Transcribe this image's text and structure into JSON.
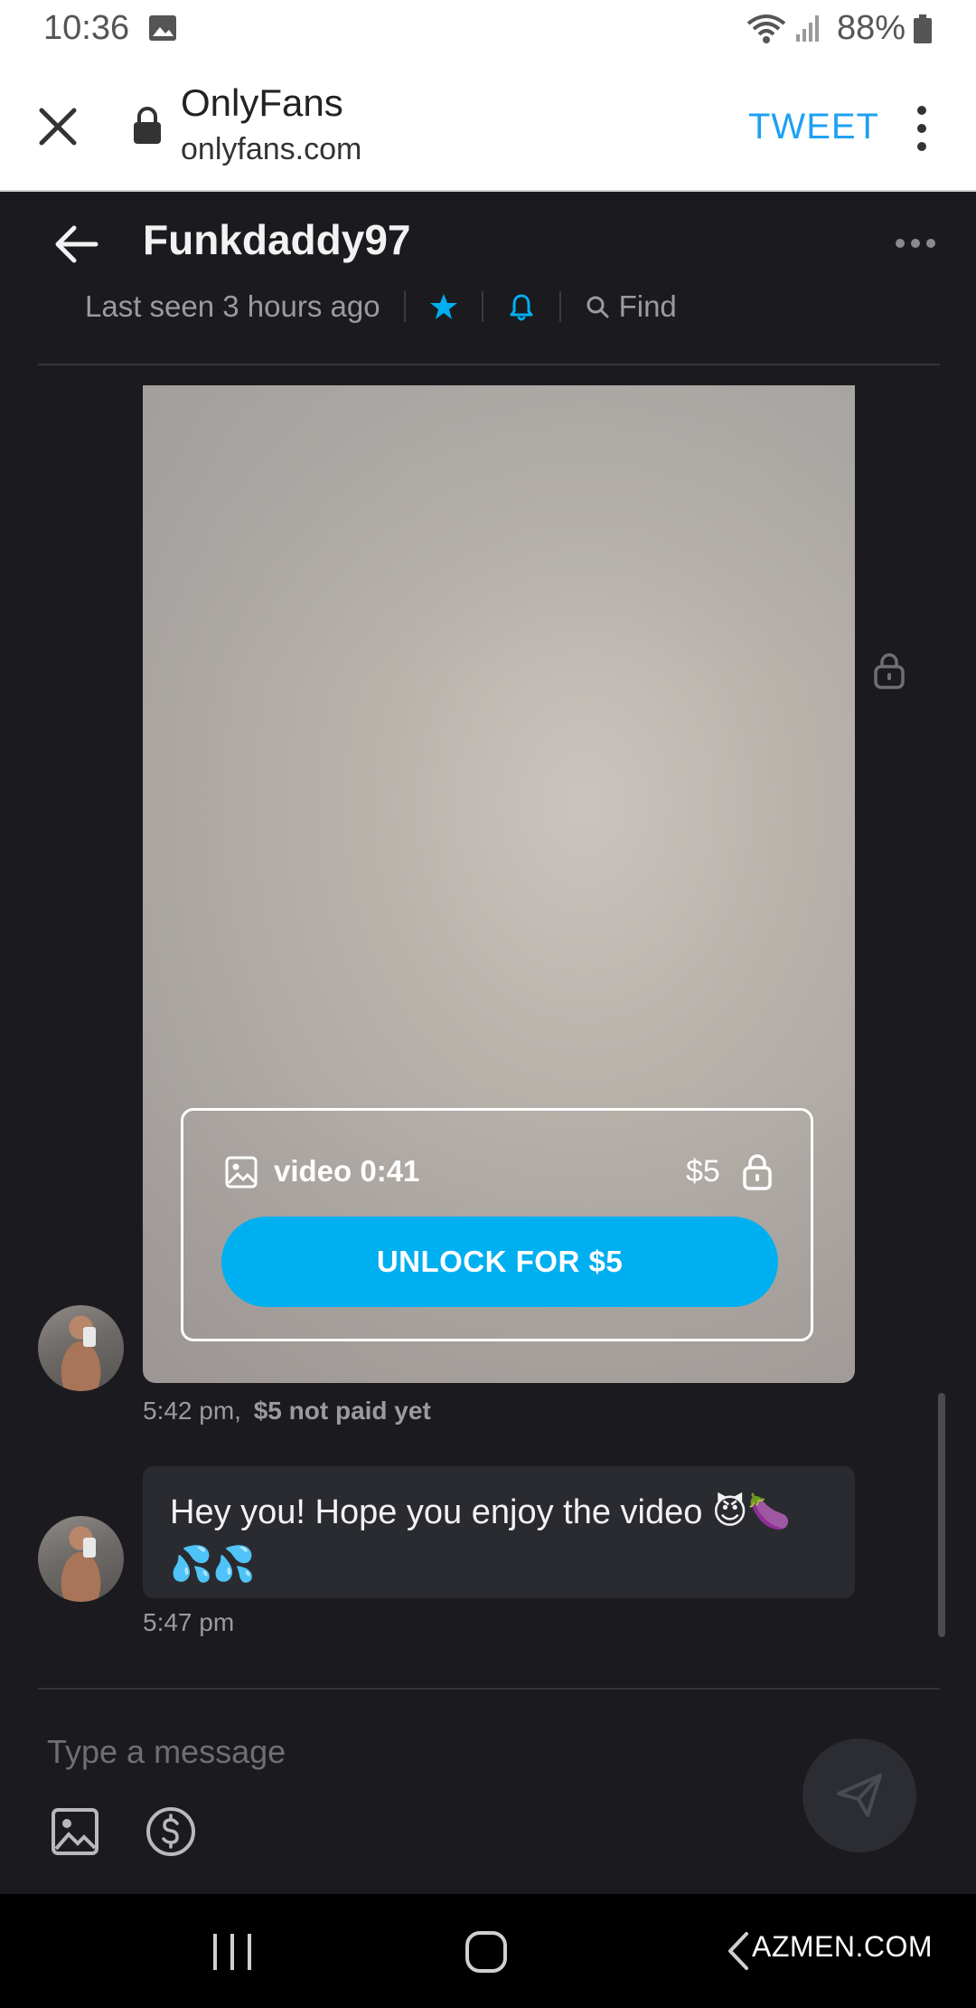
{
  "status_bar": {
    "time": "10:36",
    "battery": "88%",
    "icons": [
      "image-notification-icon",
      "wifi-icon",
      "signal-icon",
      "battery-icon"
    ]
  },
  "browser": {
    "title": "OnlyFans",
    "url": "onlyfans.com",
    "action": "TWEET",
    "action_color": "#1da1f2",
    "icons": [
      "close-icon",
      "lock-icon",
      "overflow-menu-icon"
    ]
  },
  "chat": {
    "username": "Funkdaddy97",
    "last_seen": "Last seen 3 hours ago",
    "find_label": "Find",
    "accent_color": "#00aff0"
  },
  "messages": {
    "media": {
      "label": "video 0:41",
      "price": "$5",
      "unlock_label": "UNLOCK FOR $5",
      "time": "5:42 pm,",
      "payment_status": "$5 not paid yet"
    },
    "text": {
      "body": "Hey you! Hope you enjoy the video 😈🍆💦💦",
      "time": "5:47 pm"
    }
  },
  "composer": {
    "placeholder": "Type a message",
    "icons": [
      "attach-image-icon",
      "tip-dollar-icon",
      "send-icon"
    ]
  },
  "navigation": {
    "watermark": "AZMEN.COM",
    "icons": [
      "recents-icon",
      "home-icon",
      "back-icon"
    ]
  }
}
